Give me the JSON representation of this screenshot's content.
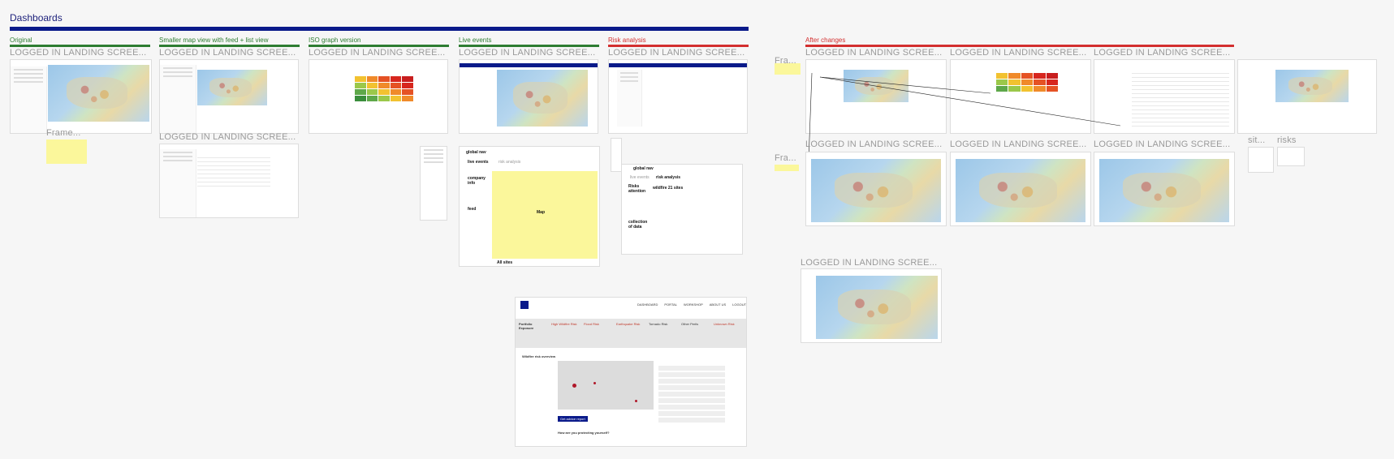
{
  "page": {
    "title": "Dashboards"
  },
  "sections": {
    "original": "Original",
    "smaller_map": "Smaller map view with feed + list view",
    "iso_graph": "ISO graph version",
    "live_events": "Live events",
    "risk_analysis": "Risk analysis",
    "after_changes": "After changes"
  },
  "frames": {
    "logged_in": "LOGGED IN  LANDING SCREE...",
    "frame_short": "Frame...",
    "fra_short": "Fra...",
    "sit_short": "sit...",
    "risks": "risks"
  },
  "wireframe_live": {
    "global_nav": "global nav",
    "tab_live": "live events",
    "tab_risk": "risk analysis",
    "company_info": "company info",
    "feed": "feed",
    "map": "Map",
    "all_sites": "All sites"
  },
  "wireframe_risk": {
    "global_nav": "global nav",
    "tab_live": "live events",
    "tab_risk": "risk analysis",
    "risks_attention": "Risks attention",
    "wildfire": "wildfire 21 sites",
    "collection": "collection of data"
  },
  "mockup": {
    "nav_items": [
      "DASHBOARD",
      "PORTAL",
      "WORKSHOP",
      "ABOUT US",
      "LOGOUT"
    ],
    "cards": [
      "Portfolio Exposure",
      "High Wildfire Risk",
      "Flood Risk",
      "Earthquake Risk",
      "Tornado Risk",
      "Other Perils",
      "Unknown Risk"
    ],
    "side_title": "Wildfire risk overview",
    "button": "Get advice report",
    "question": "How are you protecting yourself?"
  },
  "colors": {
    "accent": "#0a1a8a",
    "green_rule": "#2e7d32",
    "red_rule": "#d32f2f"
  }
}
